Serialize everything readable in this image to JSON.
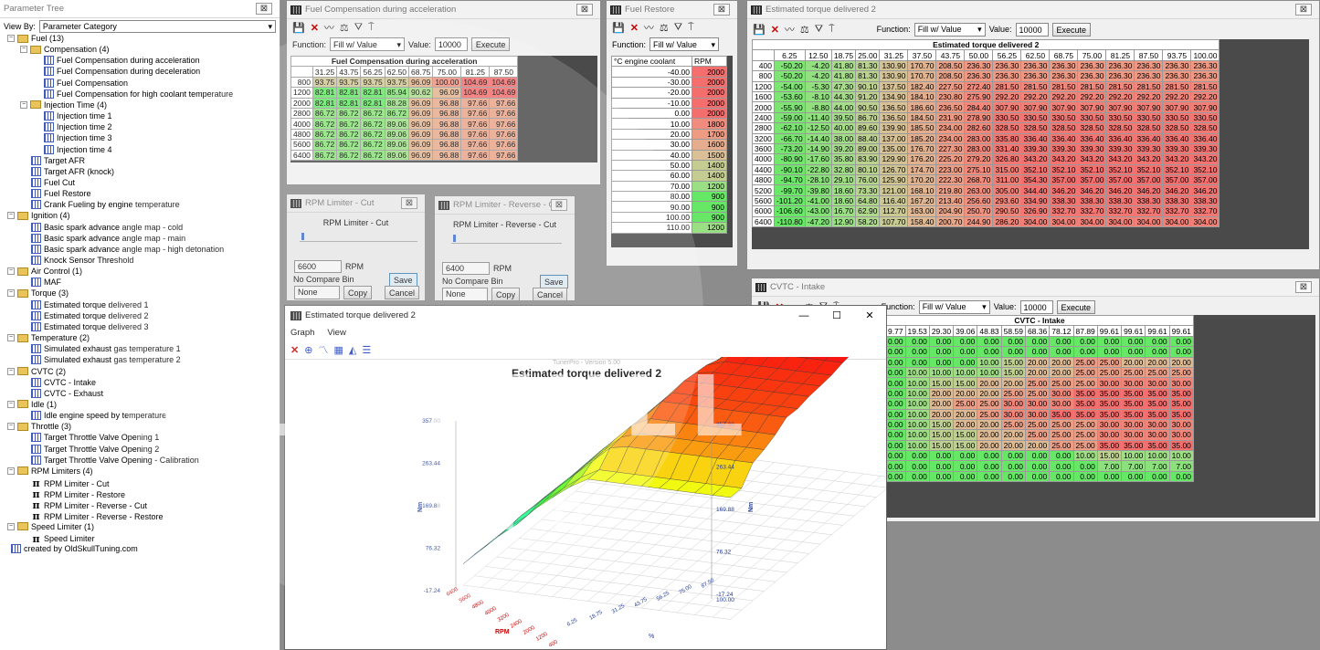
{
  "tree": {
    "title": "Parameter Tree",
    "view_by_label": "View By:",
    "view_by_value": "Parameter Category",
    "items": [
      {
        "label": "Fuel (13)",
        "level": 0,
        "type": "folder"
      },
      {
        "label": "Compensation (4)",
        "level": 1,
        "type": "folder"
      },
      {
        "label": "Fuel Compensation during acceleration",
        "level": 2,
        "type": "table"
      },
      {
        "label": "Fuel Compensation during deceleration",
        "level": 2,
        "type": "table"
      },
      {
        "label": "Fuel Compensation",
        "level": 2,
        "type": "table"
      },
      {
        "label": "Fuel Compensation for high coolant temperature",
        "level": 2,
        "type": "table"
      },
      {
        "label": "Injection Time (4)",
        "level": 1,
        "type": "folder"
      },
      {
        "label": "Injection time 1",
        "level": 2,
        "type": "table"
      },
      {
        "label": "Injection time 2",
        "level": 2,
        "type": "table"
      },
      {
        "label": "Injection time 3",
        "level": 2,
        "type": "table"
      },
      {
        "label": "Injection time 4",
        "level": 2,
        "type": "table"
      },
      {
        "label": "Target AFR",
        "level": 1,
        "type": "table"
      },
      {
        "label": "Target AFR (knock)",
        "level": 1,
        "type": "table"
      },
      {
        "label": "Fuel Cut",
        "level": 1,
        "type": "table"
      },
      {
        "label": "Fuel Restore",
        "level": 1,
        "type": "table"
      },
      {
        "label": "Crank Fueling by engine temperature",
        "level": 1,
        "type": "table"
      },
      {
        "label": "Ignition (4)",
        "level": 0,
        "type": "folder"
      },
      {
        "label": "Basic spark advance angle map - cold",
        "level": 1,
        "type": "table"
      },
      {
        "label": "Basic spark advance angle map - main",
        "level": 1,
        "type": "table"
      },
      {
        "label": "Basic spark advance angle map - high detonation",
        "level": 1,
        "type": "table"
      },
      {
        "label": "Knock Sensor Threshold",
        "level": 1,
        "type": "table"
      },
      {
        "label": "Air Control (1)",
        "level": 0,
        "type": "folder"
      },
      {
        "label": "MAF",
        "level": 1,
        "type": "table"
      },
      {
        "label": "Torque (3)",
        "level": 0,
        "type": "folder"
      },
      {
        "label": "Estimated torque delivered 1",
        "level": 1,
        "type": "table"
      },
      {
        "label": "Estimated torque delivered 2",
        "level": 1,
        "type": "table"
      },
      {
        "label": "Estimated torque delivered 3",
        "level": 1,
        "type": "table"
      },
      {
        "label": "Temperature (2)",
        "level": 0,
        "type": "folder"
      },
      {
        "label": "Simulated exhaust gas temperature 1",
        "level": 1,
        "type": "table"
      },
      {
        "label": "Simulated exhaust gas temperature 2",
        "level": 1,
        "type": "table"
      },
      {
        "label": "CVTC (2)",
        "level": 0,
        "type": "folder"
      },
      {
        "label": "CVTC - Intake",
        "level": 1,
        "type": "table"
      },
      {
        "label": "CVTC - Exhaust",
        "level": 1,
        "type": "table"
      },
      {
        "label": "Idle (1)",
        "level": 0,
        "type": "folder"
      },
      {
        "label": "Idle engine speed by temperature",
        "level": 1,
        "type": "table"
      },
      {
        "label": "Throttle (3)",
        "level": 0,
        "type": "folder"
      },
      {
        "label": "Target Throttle Valve Opening 1",
        "level": 1,
        "type": "table"
      },
      {
        "label": "Target Throttle Valve Opening 2",
        "level": 1,
        "type": "table"
      },
      {
        "label": "Target Throttle Valve Opening - Calibration",
        "level": 1,
        "type": "table"
      },
      {
        "label": "RPM Limiters (4)",
        "level": 0,
        "type": "folder"
      },
      {
        "label": "RPM Limiter - Cut",
        "level": 1,
        "type": "pi"
      },
      {
        "label": "RPM Limiter - Restore",
        "level": 1,
        "type": "pi"
      },
      {
        "label": "RPM Limiter - Reverse - Cut",
        "level": 1,
        "type": "pi"
      },
      {
        "label": "RPM Limiter - Reverse - Restore",
        "level": 1,
        "type": "pi"
      },
      {
        "label": "Speed Limiter (1)",
        "level": 0,
        "type": "folder"
      },
      {
        "label": "Speed Limiter",
        "level": 1,
        "type": "pi"
      },
      {
        "label": "created by OldSkullTuning.com",
        "level": 0,
        "type": "table"
      }
    ]
  },
  "common": {
    "function_label": "Function:",
    "function_value": "Fill w/ Value",
    "value_label": "Value:",
    "value": "10000",
    "execute": "Execute",
    "close": "⊠"
  },
  "fuelcomp": {
    "title": "Fuel Compensation during acceleration",
    "caption": "Fuel Compensation during acceleration",
    "cols": [
      "31.25",
      "43.75",
      "56.25",
      "62.50",
      "68.75",
      "75.00",
      "81.25",
      "87.50"
    ],
    "rows": [
      {
        "h": "800",
        "v": [
          "93.75",
          "93.75",
          "93.75",
          "93.75",
          "96.09",
          "100.00",
          "104.69",
          "104.69"
        ]
      },
      {
        "h": "1200",
        "v": [
          "82.81",
          "82.81",
          "82.81",
          "85.94",
          "90.62",
          "96.09",
          "104.69",
          "104.69"
        ]
      },
      {
        "h": "2000",
        "v": [
          "82.81",
          "82.81",
          "82.81",
          "88.28",
          "96.09",
          "96.88",
          "97.66",
          "97.66"
        ]
      },
      {
        "h": "2800",
        "v": [
          "86.72",
          "86.72",
          "86.72",
          "86.72",
          "96.09",
          "96.88",
          "97.66",
          "97.66"
        ]
      },
      {
        "h": "4000",
        "v": [
          "86.72",
          "86.72",
          "86.72",
          "89.06",
          "96.09",
          "96.88",
          "97.66",
          "97.66"
        ]
      },
      {
        "h": "4800",
        "v": [
          "86.72",
          "86.72",
          "86.72",
          "89.06",
          "96.09",
          "96.88",
          "97.66",
          "97.66"
        ]
      },
      {
        "h": "5600",
        "v": [
          "86.72",
          "86.72",
          "86.72",
          "89.06",
          "96.09",
          "96.88",
          "97.66",
          "97.66"
        ]
      },
      {
        "h": "6400",
        "v": [
          "86.72",
          "86.72",
          "86.72",
          "89.06",
          "96.09",
          "96.88",
          "97.66",
          "97.66"
        ]
      }
    ]
  },
  "fuelrestore": {
    "title": "Fuel Restore",
    "hdr": [
      "°C engine coolant",
      "RPM"
    ],
    "rows": [
      [
        "-40.00",
        "2000"
      ],
      [
        "-30.00",
        "2000"
      ],
      [
        "-20.00",
        "2000"
      ],
      [
        "-10.00",
        "2000"
      ],
      [
        "0.00",
        "2000"
      ],
      [
        "10.00",
        "1800"
      ],
      [
        "20.00",
        "1700"
      ],
      [
        "30.00",
        "1600"
      ],
      [
        "40.00",
        "1500"
      ],
      [
        "50.00",
        "1400"
      ],
      [
        "60.00",
        "1400"
      ],
      [
        "70.00",
        "1200"
      ],
      [
        "80.00",
        "900"
      ],
      [
        "90.00",
        "900"
      ],
      [
        "100.00",
        "900"
      ],
      [
        "110.00",
        "1200"
      ]
    ]
  },
  "rpmcut": {
    "title": "RPM Limiter - Cut",
    "label": "RPM Limiter - Cut",
    "value": "6600",
    "unit": "RPM",
    "compare": "No Compare Bin",
    "none": "None",
    "copy": "Copy",
    "save": "Save",
    "cancel": "Cancel"
  },
  "rpmrev": {
    "title": "RPM Limiter - Reverse - Cut",
    "label": "RPM Limiter - Reverse - Cut",
    "value": "6400",
    "unit": "RPM",
    "compare": "No Compare Bin",
    "none": "None",
    "copy": "Copy",
    "save": "Save",
    "cancel": "Cancel"
  },
  "torque": {
    "title": "Estimated torque delivered 2",
    "caption": "Estimated torque delivered 2",
    "cols": [
      "6.25",
      "12.50",
      "18.75",
      "25.00",
      "31.25",
      "37.50",
      "43.75",
      "50.00",
      "56.25",
      "62.50",
      "68.75",
      "75.00",
      "81.25",
      "87.50",
      "93.75",
      "100.00"
    ],
    "rows": [
      {
        "h": "400",
        "v": [
          "-50.20",
          "-4.20",
          "41.80",
          "81.30",
          "130.90",
          "170.70",
          "208.50",
          "236.30",
          "236.30",
          "236.30",
          "236.30",
          "236.30",
          "236.30",
          "236.30",
          "236.30",
          "236.30"
        ]
      },
      {
        "h": "800",
        "v": [
          "-50.20",
          "-4.20",
          "41.80",
          "81.30",
          "130.90",
          "170.70",
          "208.50",
          "236.30",
          "236.30",
          "236.30",
          "236.30",
          "236.30",
          "236.30",
          "236.30",
          "236.30",
          "236.30"
        ]
      },
      {
        "h": "1200",
        "v": [
          "-54.00",
          "-5.30",
          "47.30",
          "90.10",
          "137.50",
          "182.40",
          "227.50",
          "272.40",
          "281.50",
          "281.50",
          "281.50",
          "281.50",
          "281.50",
          "281.50",
          "281.50",
          "281.50"
        ]
      },
      {
        "h": "1600",
        "v": [
          "-53.60",
          "-8.10",
          "44.30",
          "91.20",
          "134.90",
          "184.10",
          "230.80",
          "275.90",
          "292.20",
          "292.20",
          "292.20",
          "292.20",
          "292.20",
          "292.20",
          "292.20",
          "292.20"
        ]
      },
      {
        "h": "2000",
        "v": [
          "-55.90",
          "-8.80",
          "44.00",
          "90.50",
          "136.50",
          "186.60",
          "236.50",
          "284.40",
          "307.90",
          "307.90",
          "307.90",
          "307.90",
          "307.90",
          "307.90",
          "307.90",
          "307.90"
        ]
      },
      {
        "h": "2400",
        "v": [
          "-59.00",
          "-11.40",
          "39.50",
          "86.70",
          "136.50",
          "184.50",
          "231.90",
          "278.90",
          "330.50",
          "330.50",
          "330.50",
          "330.50",
          "330.50",
          "330.50",
          "330.50",
          "330.50"
        ]
      },
      {
        "h": "2800",
        "v": [
          "-62.10",
          "-12.50",
          "40.00",
          "89.60",
          "139.90",
          "185.50",
          "234.00",
          "282.60",
          "328.50",
          "328.50",
          "328.50",
          "328.50",
          "328.50",
          "328.50",
          "328.50",
          "328.50"
        ]
      },
      {
        "h": "3200",
        "v": [
          "-66.70",
          "-14.40",
          "38.00",
          "88.40",
          "137.00",
          "185.20",
          "234.00",
          "283.00",
          "335.80",
          "336.40",
          "336.40",
          "336.40",
          "336.40",
          "336.40",
          "336.40",
          "336.40"
        ]
      },
      {
        "h": "3600",
        "v": [
          "-73.20",
          "-14.90",
          "39.20",
          "89.00",
          "135.00",
          "176.70",
          "227.30",
          "283.00",
          "331.40",
          "339.30",
          "339.30",
          "339.30",
          "339.30",
          "339.30",
          "339.30",
          "339.30"
        ]
      },
      {
        "h": "4000",
        "v": [
          "-80.90",
          "-17.60",
          "35.80",
          "83.90",
          "129.90",
          "176.20",
          "225.20",
          "279.20",
          "326.80",
          "343.20",
          "343.20",
          "343.20",
          "343.20",
          "343.20",
          "343.20",
          "343.20"
        ]
      },
      {
        "h": "4400",
        "v": [
          "-90.10",
          "-22.80",
          "32.80",
          "80.10",
          "126.70",
          "174.70",
          "223.00",
          "275.10",
          "315.00",
          "352.10",
          "352.10",
          "352.10",
          "352.10",
          "352.10",
          "352.10",
          "352.10"
        ]
      },
      {
        "h": "4800",
        "v": [
          "-94.70",
          "-28.10",
          "29.10",
          "76.00",
          "125.90",
          "170.20",
          "222.30",
          "268.70",
          "311.00",
          "354.30",
          "357.00",
          "357.00",
          "357.00",
          "357.00",
          "357.00",
          "357.00"
        ]
      },
      {
        "h": "5200",
        "v": [
          "-99.70",
          "-39.80",
          "18.60",
          "73.30",
          "121.00",
          "168.10",
          "219.80",
          "263.00",
          "305.00",
          "344.40",
          "346.20",
          "346.20",
          "346.20",
          "346.20",
          "346.20",
          "346.20"
        ]
      },
      {
        "h": "5600",
        "v": [
          "-101.20",
          "-41.00",
          "18.60",
          "64.80",
          "116.40",
          "167.20",
          "213.40",
          "256.60",
          "293.60",
          "334.90",
          "338.30",
          "338.30",
          "338.30",
          "338.30",
          "338.30",
          "338.30"
        ]
      },
      {
        "h": "6000",
        "v": [
          "-106.60",
          "-43.00",
          "16.70",
          "62.90",
          "112.70",
          "163.00",
          "204.90",
          "250.70",
          "290.50",
          "326.90",
          "332.70",
          "332.70",
          "332.70",
          "332.70",
          "332.70",
          "332.70"
        ]
      },
      {
        "h": "6400",
        "v": [
          "-110.80",
          "-47.20",
          "12.90",
          "58.20",
          "107.70",
          "158.40",
          "200.70",
          "244.90",
          "286.20",
          "304.00",
          "304.00",
          "304.00",
          "304.00",
          "304.00",
          "304.00",
          "304.00"
        ]
      }
    ]
  },
  "cvtc": {
    "title": "CVTC - Intake",
    "caption": "CVTC - Intake",
    "cols": [
      "9.77",
      "19.53",
      "29.30",
      "39.06",
      "48.83",
      "58.59",
      "68.36",
      "78.12",
      "87.89",
      "99.61",
      "99.61",
      "99.61",
      "99.61"
    ],
    "rows": [
      [
        "0.00",
        "0.00",
        "0.00",
        "0.00",
        "0.00",
        "0.00",
        "0.00",
        "0.00",
        "0.00",
        "0.00",
        "0.00",
        "0.00",
        "0.00"
      ],
      [
        "0.00",
        "0.00",
        "0.00",
        "0.00",
        "0.00",
        "0.00",
        "0.00",
        "0.00",
        "0.00",
        "0.00",
        "0.00",
        "0.00",
        "0.00"
      ],
      [
        "0.00",
        "0.00",
        "0.00",
        "0.00",
        "10.00",
        "15.00",
        "20.00",
        "20.00",
        "25.00",
        "25.00",
        "20.00",
        "20.00",
        "20.00"
      ],
      [
        "0.00",
        "10.00",
        "10.00",
        "10.00",
        "10.00",
        "15.00",
        "20.00",
        "20.00",
        "25.00",
        "25.00",
        "25.00",
        "25.00",
        "25.00"
      ],
      [
        "0.00",
        "10.00",
        "15.00",
        "15.00",
        "20.00",
        "20.00",
        "25.00",
        "25.00",
        "25.00",
        "30.00",
        "30.00",
        "30.00",
        "30.00"
      ],
      [
        "0.00",
        "10.00",
        "20.00",
        "20.00",
        "20.00",
        "25.00",
        "25.00",
        "30.00",
        "35.00",
        "35.00",
        "35.00",
        "35.00",
        "35.00"
      ],
      [
        "0.00",
        "10.00",
        "20.00",
        "25.00",
        "25.00",
        "30.00",
        "30.00",
        "30.00",
        "35.00",
        "35.00",
        "35.00",
        "35.00",
        "35.00"
      ],
      [
        "0.00",
        "10.00",
        "20.00",
        "20.00",
        "25.00",
        "30.00",
        "30.00",
        "35.00",
        "35.00",
        "35.00",
        "35.00",
        "35.00",
        "35.00"
      ],
      [
        "0.00",
        "10.00",
        "15.00",
        "20.00",
        "20.00",
        "25.00",
        "25.00",
        "25.00",
        "25.00",
        "30.00",
        "30.00",
        "30.00",
        "30.00"
      ],
      [
        "0.00",
        "10.00",
        "15.00",
        "15.00",
        "20.00",
        "20.00",
        "25.00",
        "25.00",
        "25.00",
        "30.00",
        "30.00",
        "30.00",
        "30.00"
      ],
      [
        "0.00",
        "10.00",
        "15.00",
        "15.00",
        "20.00",
        "20.00",
        "20.00",
        "25.00",
        "25.00",
        "35.00",
        "35.00",
        "35.00",
        "35.00"
      ],
      [
        "0.00",
        "0.00",
        "0.00",
        "0.00",
        "0.00",
        "0.00",
        "0.00",
        "0.00",
        "10.00",
        "15.00",
        "10.00",
        "10.00",
        "10.00"
      ],
      [
        "0.00",
        "0.00",
        "0.00",
        "0.00",
        "0.00",
        "0.00",
        "0.00",
        "0.00",
        "0.00",
        "7.00",
        "7.00",
        "7.00",
        "7.00"
      ],
      [
        "0.00",
        "0.00",
        "0.00",
        "0.00",
        "0.00",
        "0.00",
        "0.00",
        "0.00",
        "0.00",
        "0.00",
        "0.00",
        "0.00",
        "0.00"
      ]
    ]
  },
  "graph": {
    "title": "Estimated torque delivered 2",
    "menu": [
      "Graph",
      "View"
    ],
    "watermark": "TunerPro - Version 5.00",
    "chart_title": "Estimated torque delivered 2",
    "zticks": [
      "357.00",
      "263.44",
      "169.88",
      "76.32",
      "-17.24"
    ],
    "zunit": "Nm",
    "xaxis": "RPM",
    "yaxis": "%",
    "rpm_ticks": [
      "6400",
      "5600",
      "4800",
      "4000",
      "3200",
      "2400",
      "2000",
      "1200",
      "400"
    ],
    "pct_ticks": [
      "6.25",
      "18.75",
      "31.25",
      "43.75",
      "56.25",
      "75.00",
      "87.50"
    ],
    "right_bottom": "100.00",
    "win_controls": [
      "—",
      "☐",
      "✕"
    ]
  },
  "brand": {
    "skull": "OLDSKULL",
    "tuning": "TUNING"
  }
}
